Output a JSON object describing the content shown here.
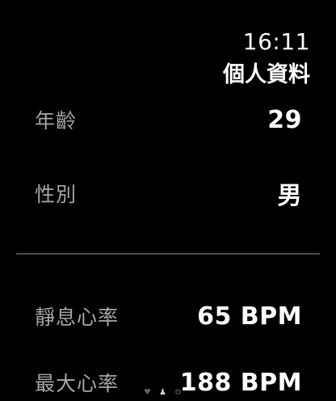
{
  "status": {
    "time": "16:11"
  },
  "header": {
    "title": "個人資料"
  },
  "profile": {
    "age": {
      "label": "年齡",
      "value": "29"
    },
    "sex": {
      "label": "性別",
      "value": "男"
    }
  },
  "heart": {
    "resting": {
      "label": "靜息心率",
      "value": "65 BPM"
    },
    "max": {
      "label": "最大心率",
      "value": "188 BPM"
    }
  },
  "page_indicator": {
    "icons": [
      "heart-icon",
      "person-icon",
      "gear-icon"
    ],
    "active": "person-icon"
  }
}
